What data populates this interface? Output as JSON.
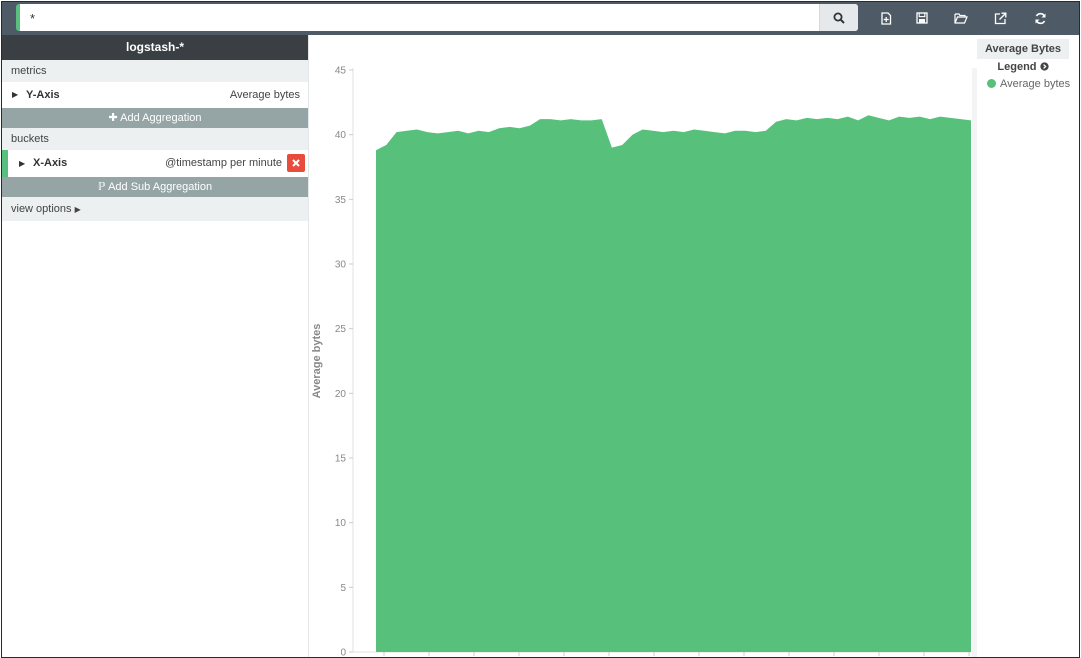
{
  "query": {
    "value": "*"
  },
  "toolbar": {
    "search_icon": "search-icon",
    "icons": [
      "new-document-icon",
      "save-icon",
      "open-folder-icon",
      "share-icon",
      "refresh-icon"
    ]
  },
  "sidebar": {
    "index_pattern": "logstash-*",
    "metrics_label": "metrics",
    "y_axis": {
      "name": "Y-Axis",
      "desc": "Average bytes"
    },
    "add_aggregation": "Add Aggregation",
    "buckets_label": "buckets",
    "x_axis": {
      "name": "X-Axis",
      "desc": "@timestamp per minute"
    },
    "add_sub_aggregation": "Add Sub Aggregation",
    "view_options": "view options"
  },
  "legend": {
    "title": "Average Bytes",
    "toggle": "Legend",
    "item": "Average bytes"
  },
  "colors": {
    "series": "#57c17b",
    "accent": "#58bf7f",
    "danger": "#e74c3c"
  },
  "chart_data": {
    "type": "area",
    "title": "Average Bytes",
    "ylabel": "Average bytes",
    "xlabel": "",
    "ylim": [
      0,
      45
    ],
    "yticks": [
      0,
      5,
      10,
      15,
      20,
      25,
      30,
      35,
      40,
      45
    ],
    "grid": false,
    "legend_position": "right",
    "series": [
      {
        "name": "Average bytes",
        "values": [
          38.8,
          39.2,
          40.2,
          40.3,
          40.4,
          40.2,
          40.1,
          40.2,
          40.3,
          40.1,
          40.3,
          40.2,
          40.5,
          40.6,
          40.5,
          40.7,
          41.2,
          41.2,
          41.1,
          41.2,
          41.1,
          41.1,
          41.2,
          39.0,
          39.2,
          40.0,
          40.4,
          40.3,
          40.2,
          40.3,
          40.2,
          40.4,
          40.3,
          40.2,
          40.1,
          40.3,
          40.3,
          40.2,
          40.3,
          41.0,
          41.2,
          41.1,
          41.3,
          41.2,
          41.3,
          41.2,
          41.4,
          41.1,
          41.5,
          41.3,
          41.1,
          41.4,
          41.3,
          41.4,
          41.2,
          41.4,
          41.3,
          41.2,
          41.1
        ]
      }
    ]
  }
}
